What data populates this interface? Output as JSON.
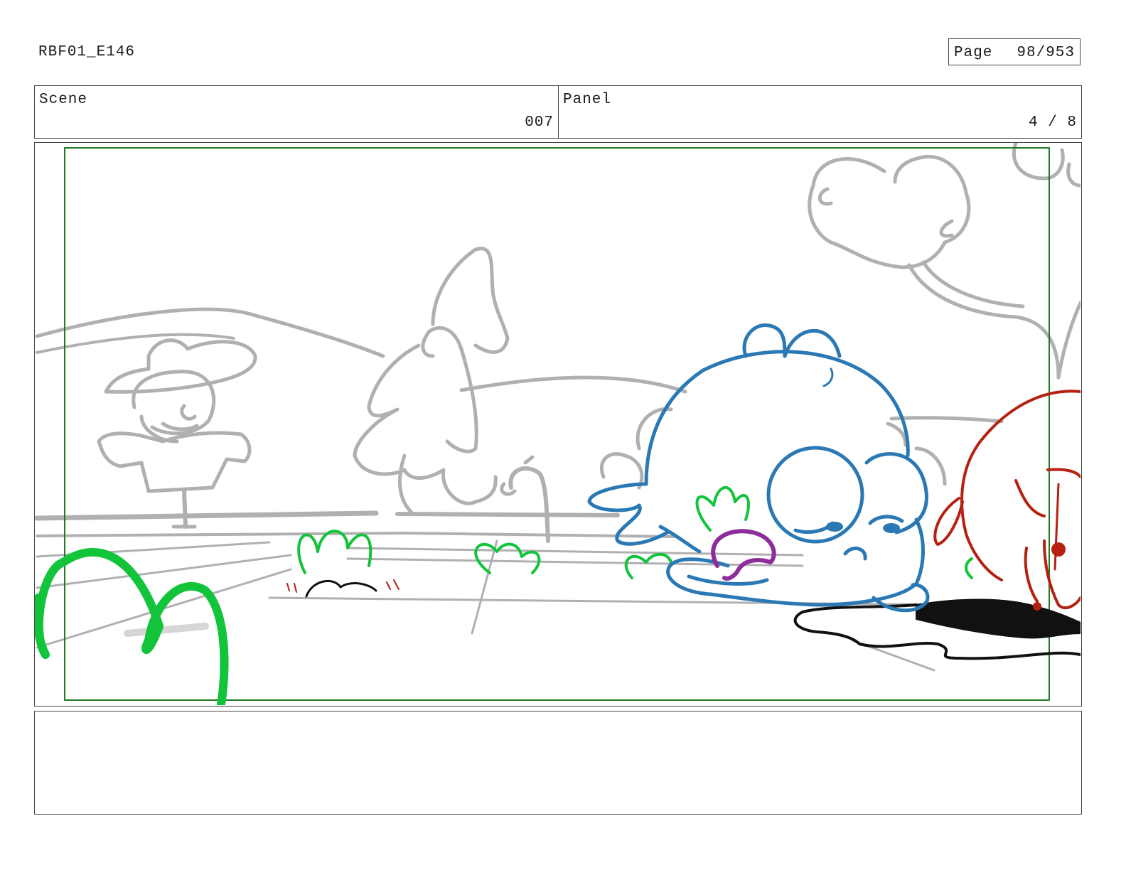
{
  "header": {
    "doc_id": "RBF01_E146",
    "page_label": "Page",
    "page_number": "98/953"
  },
  "info": {
    "scene_label": "Scene",
    "scene_value": "007",
    "panel_label": "Panel",
    "panel_value": "4 / 8"
  },
  "colors": {
    "sketch_gray": "#b0b0b0",
    "safe_frame": "#1f7a1f",
    "grass_green": "#11c43a",
    "character_blue": "#2a78b4",
    "character_red": "#b52010",
    "mouth_purple": "#8e2d9a",
    "border": "#444444"
  },
  "icons": [
    "scarecrow-sketch",
    "tree-sketch",
    "cloud-tree-sketch",
    "faucet-sketch",
    "round-creature",
    "red-creature",
    "hole-shadow",
    "grass-tufts"
  ],
  "notes": {
    "text": ""
  }
}
